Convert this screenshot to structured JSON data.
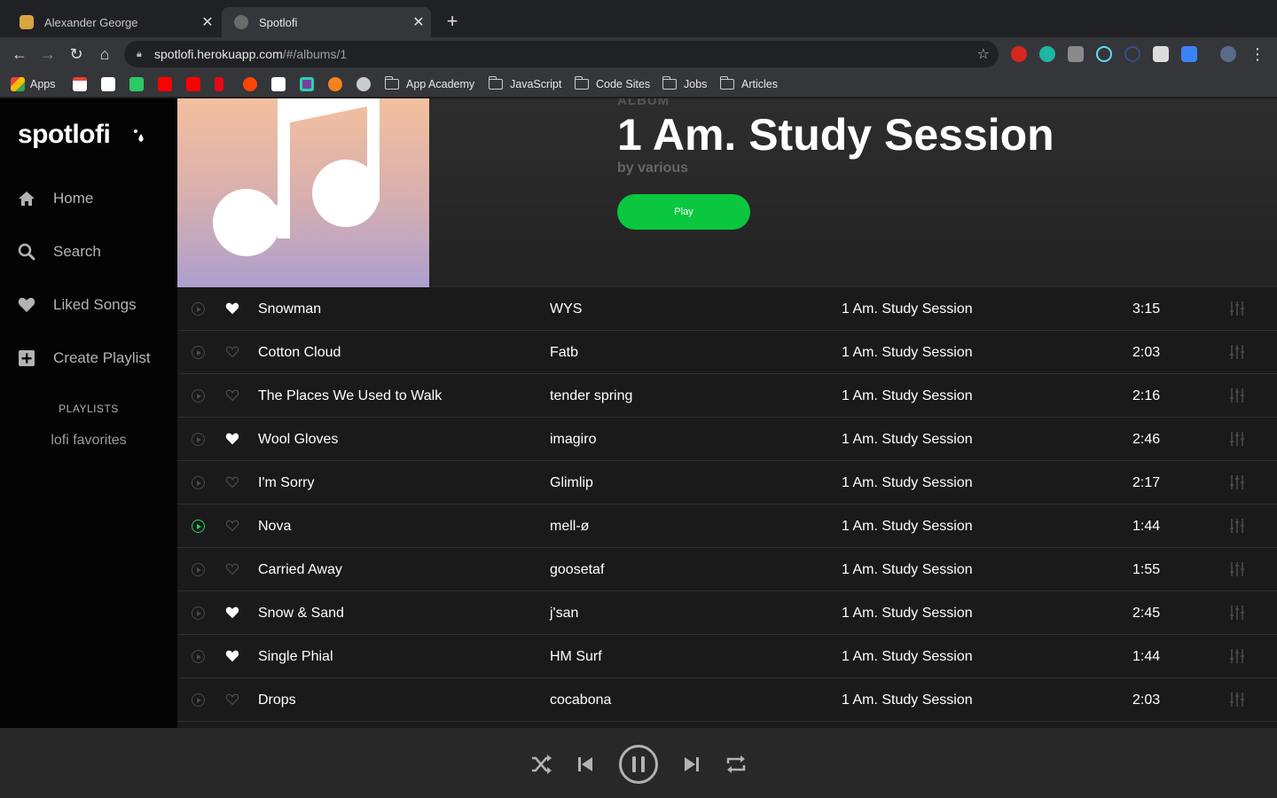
{
  "browser": {
    "tabs": [
      {
        "title": "Alexander George",
        "active": false
      },
      {
        "title": "Spotlofi",
        "active": true
      }
    ],
    "url": {
      "host": "spotlofi.herokuapp.com",
      "path": "/#/albums/1"
    },
    "bookmarks": {
      "apps": "Apps",
      "folders": [
        "App Academy",
        "JavaScript",
        "Code Sites",
        "Jobs",
        "Articles"
      ]
    }
  },
  "sidebar": {
    "logo": "spotlofi",
    "nav": [
      {
        "label": "Home",
        "icon": "home-icon"
      },
      {
        "label": "Search",
        "icon": "search-icon"
      },
      {
        "label": "Liked Songs",
        "icon": "heart-icon"
      },
      {
        "label": "Create Playlist",
        "icon": "plus-square-icon"
      }
    ],
    "playlists_heading": "PLAYLISTS",
    "playlists": [
      "lofi favorites"
    ]
  },
  "album": {
    "type": "ALBUM",
    "title": "1 Am. Study Session",
    "by": "by various",
    "play_label": "Play"
  },
  "tracks": [
    {
      "title": "Snowman",
      "artist": "WYS",
      "album": "1 Am. Study Session",
      "duration": "3:15",
      "liked": true,
      "playing": false
    },
    {
      "title": "Cotton Cloud",
      "artist": "Fatb",
      "album": "1 Am. Study Session",
      "duration": "2:03",
      "liked": false,
      "playing": false
    },
    {
      "title": "The Places We Used to Walk",
      "artist": "tender spring",
      "album": "1 Am. Study Session",
      "duration": "2:16",
      "liked": false,
      "playing": false
    },
    {
      "title": "Wool Gloves",
      "artist": "imagiro",
      "album": "1 Am. Study Session",
      "duration": "2:46",
      "liked": true,
      "playing": false
    },
    {
      "title": "I'm Sorry",
      "artist": "Glimlip",
      "album": "1 Am. Study Session",
      "duration": "2:17",
      "liked": false,
      "playing": false
    },
    {
      "title": "Nova",
      "artist": "mell-ø",
      "album": "1 Am. Study Session",
      "duration": "1:44",
      "liked": false,
      "playing": true
    },
    {
      "title": "Carried Away",
      "artist": "goosetaf",
      "album": "1 Am. Study Session",
      "duration": "1:55",
      "liked": false,
      "playing": false
    },
    {
      "title": "Snow & Sand",
      "artist": "j'san",
      "album": "1 Am. Study Session",
      "duration": "2:45",
      "liked": true,
      "playing": false
    },
    {
      "title": "Single Phial",
      "artist": "HM Surf",
      "album": "1 Am. Study Session",
      "duration": "1:44",
      "liked": true,
      "playing": false
    },
    {
      "title": "Drops",
      "artist": "cocabona",
      "album": "1 Am. Study Session",
      "duration": "2:03",
      "liked": false,
      "playing": false
    }
  ],
  "player": {
    "controls": [
      "shuffle-icon",
      "previous-icon",
      "pause-icon",
      "next-icon",
      "repeat-icon"
    ]
  },
  "colors": {
    "accent": "#0ac73f",
    "sidebar_bg": "#040404",
    "main_bg": "#1a1a1a",
    "player_bg": "#282828"
  }
}
